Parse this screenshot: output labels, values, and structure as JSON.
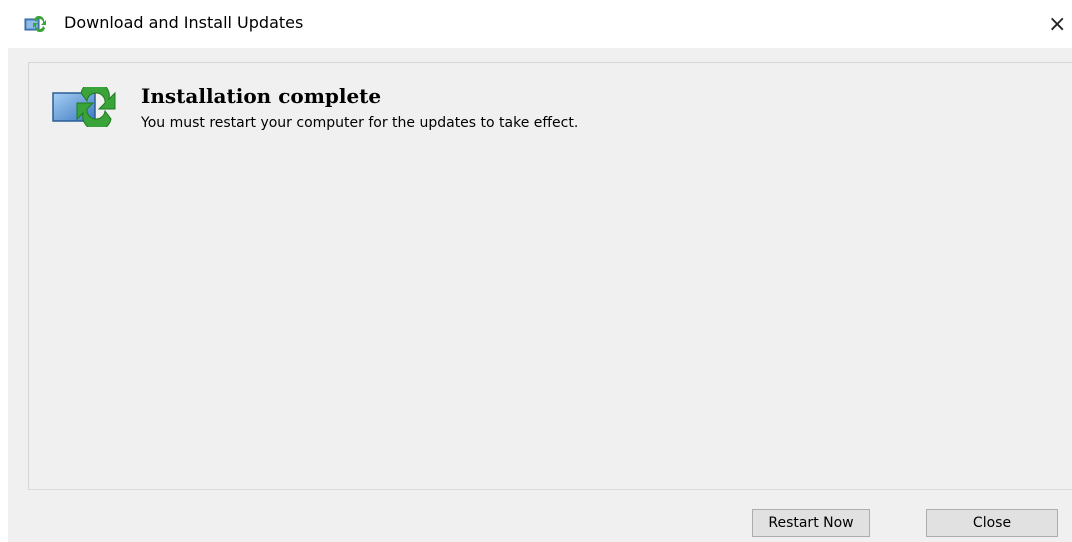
{
  "window": {
    "title": "Download and Install Updates",
    "title_icon": "windows-update-icon",
    "close_glyph": "×"
  },
  "status": {
    "icon": "windows-update-icon",
    "heading": "Installation complete",
    "message": "You must restart your computer for the updates to take effect."
  },
  "buttons": {
    "restart_label": "Restart Now",
    "close_label": "Close"
  },
  "colors": {
    "client_background": "#f0f0f0",
    "button_background": "#e1e1e1",
    "button_border": "#adadad",
    "icon_green": "#3aa33a",
    "icon_blue": "#4a86c8"
  }
}
